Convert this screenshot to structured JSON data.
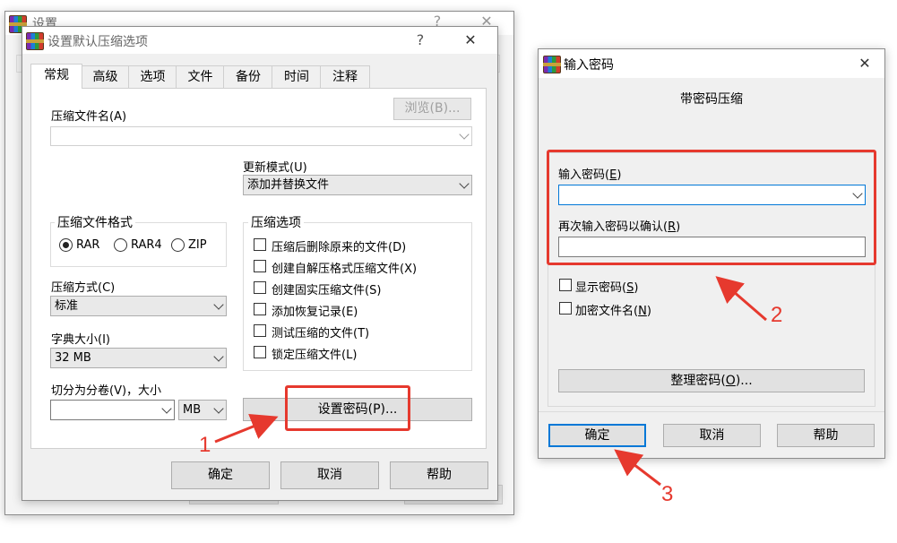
{
  "back_window": {
    "title": "设置"
  },
  "main_dialog": {
    "title": "设置默认压缩选项",
    "help_glyph": "?",
    "close_glyph": "✕",
    "tabs": [
      {
        "label": "常规",
        "active": true
      },
      {
        "label": "高级"
      },
      {
        "label": "选项"
      },
      {
        "label": "文件"
      },
      {
        "label": "备份"
      },
      {
        "label": "时间"
      },
      {
        "label": "注释"
      }
    ],
    "archive_name_label": "压缩文件名(A)",
    "browse_button": "浏览(B)...",
    "archive_name_value": "",
    "update_mode_label": "更新模式(U)",
    "update_mode_value": "添加并替换文件",
    "format_group": {
      "legend": "压缩文件格式",
      "options": [
        {
          "label": "RAR",
          "selected": true
        },
        {
          "label": "RAR4",
          "selected": false
        },
        {
          "label": "ZIP",
          "selected": false
        }
      ]
    },
    "options_group": {
      "legend": "压缩选项",
      "items": [
        {
          "label": "压缩后删除原来的文件(D)",
          "checked": false
        },
        {
          "label": "创建自解压格式压缩文件(X)",
          "checked": false
        },
        {
          "label": "创建固实压缩文件(S)",
          "checked": false
        },
        {
          "label": "添加恢复记录(E)",
          "checked": false
        },
        {
          "label": "测试压缩的文件(T)",
          "checked": false
        },
        {
          "label": "锁定压缩文件(L)",
          "checked": false
        }
      ]
    },
    "method_label": "压缩方式(C)",
    "method_value": "标准",
    "dict_label": "字典大小(I)",
    "dict_value": "32 MB",
    "split_label": "切分为分卷(V)，大小",
    "split_value": "",
    "split_unit": "MB",
    "set_password_button": "设置密码(P)...",
    "ok_button": "确定",
    "cancel_button": "取消",
    "help_button": "帮助"
  },
  "password_dialog": {
    "title": "输入密码",
    "close_glyph": "✕",
    "heading": "带密码压缩",
    "enter_label": "输入密码",
    "enter_key": "E",
    "confirm_label": "再次输入密码以确认",
    "confirm_key": "R",
    "enter_value": "",
    "confirm_value": "",
    "show_password": "显示密码",
    "show_key": "S",
    "encrypt_names": "加密文件名",
    "encrypt_key": "N",
    "organize_button": "整理密码",
    "organize_key": "O",
    "organize_suffix": "...",
    "ok_button": "确定",
    "cancel_button": "取消",
    "help_button": "帮助"
  },
  "annotations": {
    "step1": "1",
    "step2": "2",
    "step3": "3",
    "color": "#e6392e"
  }
}
